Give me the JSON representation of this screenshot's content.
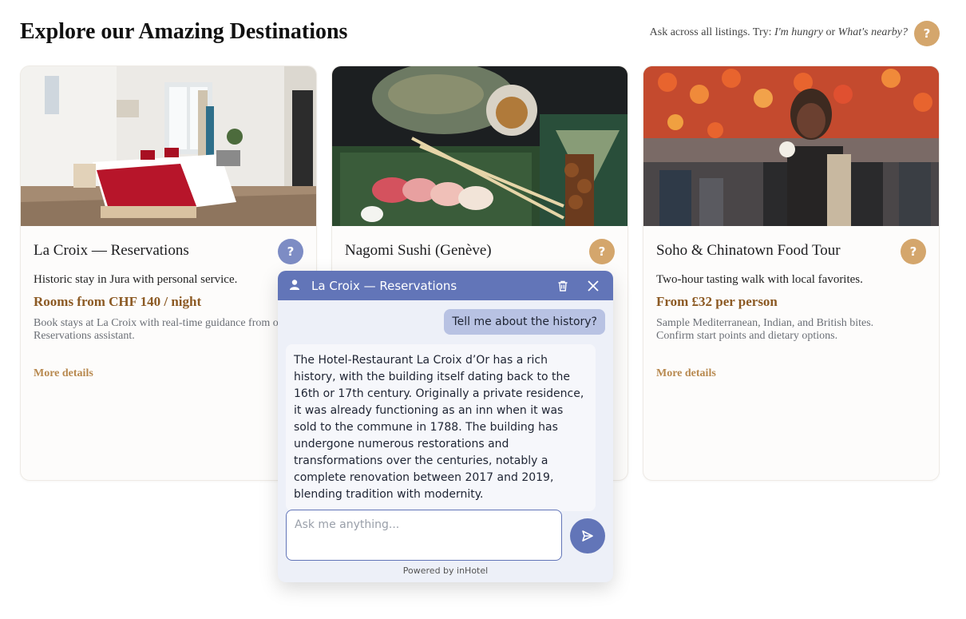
{
  "header": {
    "title": "Explore our Amazing Destinations",
    "hint_prefix": "Ask across all listings. Try: ",
    "hint_example1": "I'm hungry",
    "hint_or": " or ",
    "hint_example2": "What's nearby?",
    "help_label": "?"
  },
  "cards": [
    {
      "name": "La Croix — Reservations",
      "help_label": "?",
      "help_color": "#7d8cc4",
      "tagline": "Historic stay in Jura with personal service.",
      "price": "Rooms from CHF 140 / night",
      "description": "Book stays at La Croix with real-time guidance from our Reservations assistant.",
      "more_label": "More details"
    },
    {
      "name": "Nagomi Sushi (Genève)",
      "help_label": "?",
      "help_color": "#d4a66c",
      "tagline": "",
      "price": "",
      "description": "",
      "more_label": ""
    },
    {
      "name": "Soho & Chinatown Food Tour",
      "help_label": "?",
      "help_color": "#d4a66c",
      "tagline": "Two-hour tasting walk with local favorites.",
      "price": "From £32 per person",
      "description": "Sample Mediterranean, Indian, and British bites. Confirm start points and dietary options.",
      "more_label": "More details"
    }
  ],
  "chat": {
    "title": "La Croix — Reservations",
    "user_message": "Tell me about the history?",
    "bot_message": "The Hotel-Restaurant La Croix d’Or has a rich history, with the building itself dating back to the 16th or 17th century. Originally a private residence, it was already functioning as an inn when it was sold to the commune in 1788. The building has undergone numerous restorations and transformations over the centuries, notably a complete renovation between 2017 and 2019, blending tradition with modernity.",
    "input_value": "",
    "input_placeholder": "Ask me anything...",
    "powered_by": "Powered by inHotel",
    "icons": {
      "user": "user-icon",
      "delete": "trash-icon",
      "close": "close-icon",
      "send": "send-icon"
    }
  }
}
